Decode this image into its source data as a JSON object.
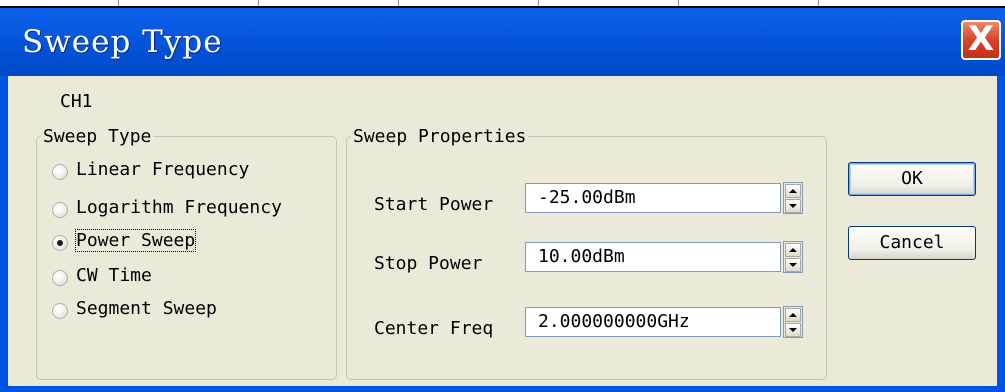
{
  "window": {
    "title": "Sweep Type",
    "close_label": "X"
  },
  "channel_label": "CH1",
  "sweep_type_group": {
    "legend": "Sweep Type",
    "options": [
      {
        "label": "Linear Frequency",
        "selected": false
      },
      {
        "label": "Logarithm Frequency",
        "selected": false
      },
      {
        "label": "Power Sweep",
        "selected": true
      },
      {
        "label": "CW Time",
        "selected": false
      },
      {
        "label": "Segment Sweep",
        "selected": false
      }
    ]
  },
  "sweep_properties_group": {
    "legend": "Sweep Properties",
    "fields": [
      {
        "label": "Start Power",
        "value": "-25.00dBm"
      },
      {
        "label": "Stop Power",
        "value": "10.00dBm"
      },
      {
        "label": "Center Freq",
        "value": "2.000000000GHz"
      }
    ]
  },
  "buttons": {
    "ok_label": "OK",
    "cancel_label": "Cancel"
  }
}
